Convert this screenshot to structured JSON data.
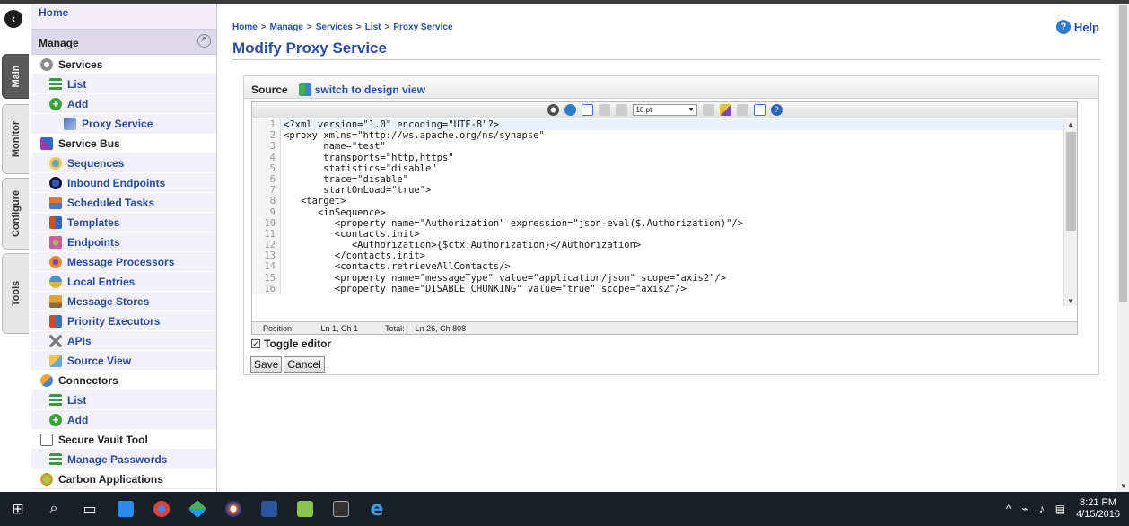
{
  "window": {
    "title": "Modify Proxy Service"
  },
  "vertical_tabs": [
    {
      "label": "Main",
      "active": true
    },
    {
      "label": "Monitor",
      "active": false
    },
    {
      "label": "Configure",
      "active": false
    },
    {
      "label": "Tools",
      "active": false
    }
  ],
  "menu": {
    "home": "Home",
    "manage": "Manage",
    "items": [
      {
        "label": "Services",
        "level": "cat",
        "icon": "gear-icon"
      },
      {
        "label": "List",
        "level": "sub",
        "icon": "list-icon"
      },
      {
        "label": "Add",
        "level": "sub",
        "icon": "add-icon"
      },
      {
        "label": "Proxy Service",
        "level": "sub2",
        "icon": "proxy-icon"
      },
      {
        "label": "Service Bus",
        "level": "cat",
        "icon": "service-bus-icon"
      },
      {
        "label": "Sequences",
        "level": "sub",
        "icon": "sequences-icon"
      },
      {
        "label": "Inbound Endpoints",
        "level": "sub",
        "icon": "inbound-endpoints-icon"
      },
      {
        "label": "Scheduled Tasks",
        "level": "sub",
        "icon": "scheduled-tasks-icon"
      },
      {
        "label": "Templates",
        "level": "sub",
        "icon": "templates-icon"
      },
      {
        "label": "Endpoints",
        "level": "sub",
        "icon": "endpoints-icon"
      },
      {
        "label": "Message Processors",
        "level": "sub",
        "icon": "message-processors-icon"
      },
      {
        "label": "Local Entries",
        "level": "sub",
        "icon": "local-entries-icon"
      },
      {
        "label": "Message Stores",
        "level": "sub",
        "icon": "message-stores-icon"
      },
      {
        "label": "Priority Executors",
        "level": "sub",
        "icon": "priority-executors-icon"
      },
      {
        "label": "APIs",
        "level": "sub",
        "icon": "apis-icon"
      },
      {
        "label": "Source View",
        "level": "sub",
        "icon": "source-view-icon"
      },
      {
        "label": "Connectors",
        "level": "cat",
        "icon": "connectors-icon"
      },
      {
        "label": "List",
        "level": "sub",
        "icon": "list-icon"
      },
      {
        "label": "Add",
        "level": "sub",
        "icon": "add-icon"
      },
      {
        "label": "Secure Vault Tool",
        "level": "cat",
        "icon": "secure-vault-icon"
      },
      {
        "label": "Manage Passwords",
        "level": "sub",
        "icon": "list-icon"
      },
      {
        "label": "Carbon Applications",
        "level": "cat",
        "icon": "carbon-applications-icon"
      }
    ]
  },
  "breadcrumb": [
    "Home",
    "Manage",
    "Services",
    "List",
    "Proxy Service"
  ],
  "breadcrumb_sep": ">",
  "help_label": "Help",
  "page_title": "Modify Proxy Service",
  "panel": {
    "source_label": "Source",
    "switch_label": "switch to design view"
  },
  "toolbar": {
    "font_size": "10 pt"
  },
  "code_lines": [
    "<?xml version=\"1.0\" encoding=\"UTF-8\"?>",
    "<proxy xmlns=\"http://ws.apache.org/ns/synapse\"",
    "       name=\"test\"",
    "       transports=\"http,https\"",
    "       statistics=\"disable\"",
    "       trace=\"disable\"",
    "       startOnLoad=\"true\">",
    "   <target>",
    "      <inSequence>",
    "         <property name=\"Authorization\" expression=\"json-eval($.Authorization)\"/>",
    "         <contacts.init>",
    "            <Authorization>{$ctx:Authorization}</Authorization>",
    "         </contacts.init>",
    "         <contacts.retrieveAllContacts/>",
    "         <property name=\"messageType\" value=\"application/json\" scope=\"axis2\"/>",
    "         <property name=\"DISABLE_CHUNKING\" value=\"true\" scope=\"axis2\"/>"
  ],
  "status_bar": {
    "position_label": "Position:",
    "position_value": "Ln 1, Ch 1",
    "total_label": "Total:",
    "total_value": "Ln 26, Ch 808"
  },
  "toggle_editor": {
    "label": "Toggle editor",
    "checked": true
  },
  "buttons": {
    "save": "Save",
    "cancel": "Cancel"
  },
  "taskbar": {
    "time": "8:21 PM",
    "date": "4/15/2016"
  }
}
